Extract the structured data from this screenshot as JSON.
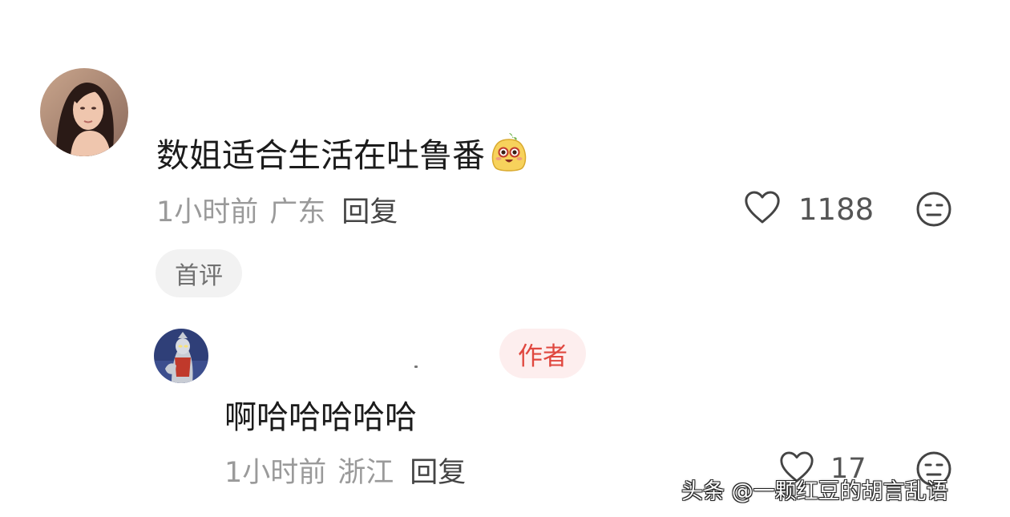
{
  "comment": {
    "text": "数姐适合生活在吐鲁番",
    "emoji_icon": "yellow-bean-smile-emoji-icon",
    "time": "1小时前",
    "location": "广东",
    "reply_label": "回复",
    "like_count": "1188",
    "badge": "首评"
  },
  "reply": {
    "author_badge": "作者",
    "text": "啊哈哈哈哈哈",
    "time": "1小时前",
    "location": "浙江",
    "reply_label": "回复",
    "like_count": "17"
  },
  "watermark": {
    "text": "头条 @一颗红豆的胡言乱语"
  },
  "colors": {
    "primary_text": "#1b1b1b",
    "meta_text": "#9a9a9a",
    "author_badge_bg": "#fdeeee",
    "author_badge_text": "#e0473f",
    "first_badge_bg": "#f2f2f2"
  }
}
